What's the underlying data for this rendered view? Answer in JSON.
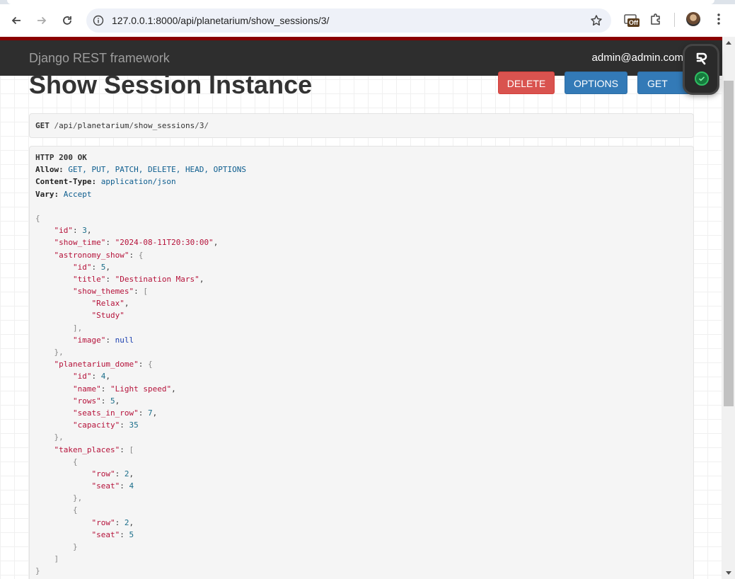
{
  "browser": {
    "url": "127.0.0.1:8000/api/planetarium/show_sessions/3/",
    "extension_badge": "Off"
  },
  "navbar": {
    "brand": "Django REST framework",
    "user": "admin@admin.com"
  },
  "page": {
    "title": "Show Session Instance",
    "buttons": {
      "delete": "DELETE",
      "options": "OPTIONS",
      "get": "GET"
    }
  },
  "request": {
    "method": "GET",
    "path_segments": [
      "api",
      "planetarium",
      "show_sessions",
      "3"
    ]
  },
  "response": {
    "status": "HTTP 200 OK",
    "headers": [
      {
        "name": "Allow:",
        "value": "GET, PUT, PATCH, DELETE, HEAD, OPTIONS"
      },
      {
        "name": "Content-Type:",
        "value": "application/json"
      },
      {
        "name": "Vary:",
        "value": "Accept"
      }
    ],
    "body": {
      "id": 3,
      "show_time": "\"2024-08-11T20:30:00\"",
      "astronomy_show": {
        "id": 5,
        "title": "\"Destination Mars\"",
        "show_themes": [
          "\"Relax\"",
          "\"Study\""
        ],
        "image": "null"
      },
      "planetarium_dome": {
        "id": 4,
        "name": "\"Light speed\"",
        "rows": 5,
        "seats_in_row": 7,
        "capacity": 35
      },
      "taken_places": [
        {
          "row": 2,
          "seat": 4
        },
        {
          "row": 2,
          "seat": 5
        }
      ]
    }
  },
  "colors": {
    "navbar": "#2e2e2e",
    "accent_red": "#8a0000",
    "delete": "#d9534f",
    "primary": "#337ab7"
  }
}
